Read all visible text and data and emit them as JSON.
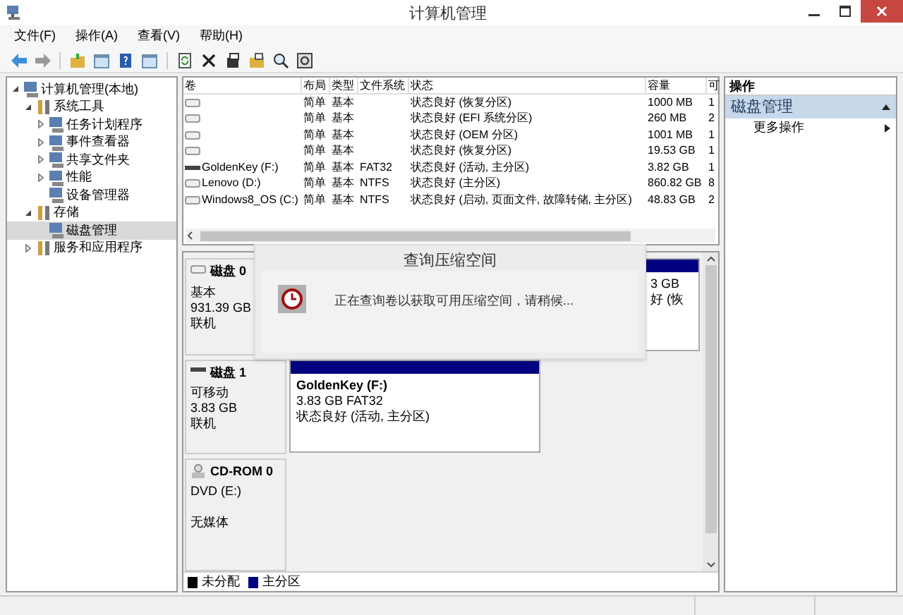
{
  "window": {
    "title": "计算机管理"
  },
  "menu": [
    {
      "label": "文件(F)"
    },
    {
      "label": "操作(A)"
    },
    {
      "label": "查看(V)"
    },
    {
      "label": "帮助(H)"
    }
  ],
  "tree": [
    {
      "label": "计算机管理(本地)",
      "expanded": true,
      "selected": false,
      "children": [
        {
          "label": "系统工具",
          "expanded": true,
          "selected": false,
          "children": [
            {
              "label": "任务计划程序",
              "expanded": false,
              "selected": false
            },
            {
              "label": "事件查看器",
              "expanded": false,
              "selected": false
            },
            {
              "label": "共享文件夹",
              "expanded": false,
              "selected": false
            },
            {
              "label": "性能",
              "expanded": false,
              "selected": false
            },
            {
              "label": "设备管理器",
              "selected": false
            }
          ]
        },
        {
          "label": "存储",
          "expanded": true,
          "selected": false,
          "children": [
            {
              "label": "磁盘管理",
              "selected": true
            }
          ]
        },
        {
          "label": "服务和应用程序",
          "expanded": false,
          "selected": false
        }
      ]
    }
  ],
  "volumes": {
    "columns": [
      "卷",
      "布局",
      "类型",
      "文件系统",
      "状态",
      "容量",
      "可"
    ],
    "rows": [
      {
        "kind": "disk",
        "cells": [
          "",
          "简单",
          "基本",
          "",
          "状态良好 (恢复分区)",
          "1000 MB",
          "1"
        ]
      },
      {
        "kind": "disk",
        "cells": [
          "",
          "简单",
          "基本",
          "",
          "状态良好 (EFI 系统分区)",
          "260 MB",
          "2"
        ]
      },
      {
        "kind": "disk",
        "cells": [
          "",
          "简单",
          "基本",
          "",
          "状态良好 (OEM 分区)",
          "1001 MB",
          "1"
        ]
      },
      {
        "kind": "disk",
        "cells": [
          "",
          "简单",
          "基本",
          "",
          "状态良好 (恢复分区)",
          "19.53 GB",
          "1"
        ]
      },
      {
        "kind": "removable",
        "cells": [
          "GoldenKey (F:)",
          "简单",
          "基本",
          "FAT32",
          "状态良好 (活动, 主分区)",
          "3.82 GB",
          "1"
        ]
      },
      {
        "kind": "disk",
        "cells": [
          "Lenovo (D:)",
          "简单",
          "基本",
          "NTFS",
          "状态良好 (主分区)",
          "860.82 GB",
          "8"
        ]
      },
      {
        "kind": "disk",
        "cells": [
          "Windows8_OS (C:)",
          "简单",
          "基本",
          "NTFS",
          "状态良好 (启动, 页面文件, 故障转储, 主分区)",
          "48.83 GB",
          "2"
        ]
      }
    ]
  },
  "disks": [
    {
      "kind": "disk",
      "name": "磁盘 0",
      "lines": [
        "基本",
        "931.39 GB",
        "联机"
      ],
      "partitions": [
        {
          "lines": [
            "3 GB",
            "好 (恢"
          ]
        }
      ]
    },
    {
      "kind": "removable",
      "name": "磁盘 1",
      "lines": [
        "可移动",
        "3.83 GB",
        "联机"
      ],
      "partitions": [
        {
          "title": "GoldenKey  (F:)",
          "lines": [
            "3.83 GB FAT32",
            "状态良好 (活动, 主分区)"
          ]
        }
      ]
    },
    {
      "kind": "cdrom",
      "name": "CD-ROM 0",
      "lines": [
        "DVD (E:)",
        "无媒体"
      ]
    }
  ],
  "legend": [
    {
      "label": "未分配",
      "color": "#000000"
    },
    {
      "label": "主分区",
      "color": "#000080"
    }
  ],
  "dialog": {
    "title": "查询压缩空间",
    "message": "正在查询卷以获取可用压缩空间，请稍候..."
  },
  "actions": {
    "title": "操作",
    "section": "磁盘管理",
    "items": [
      {
        "label": "更多操作"
      }
    ]
  }
}
